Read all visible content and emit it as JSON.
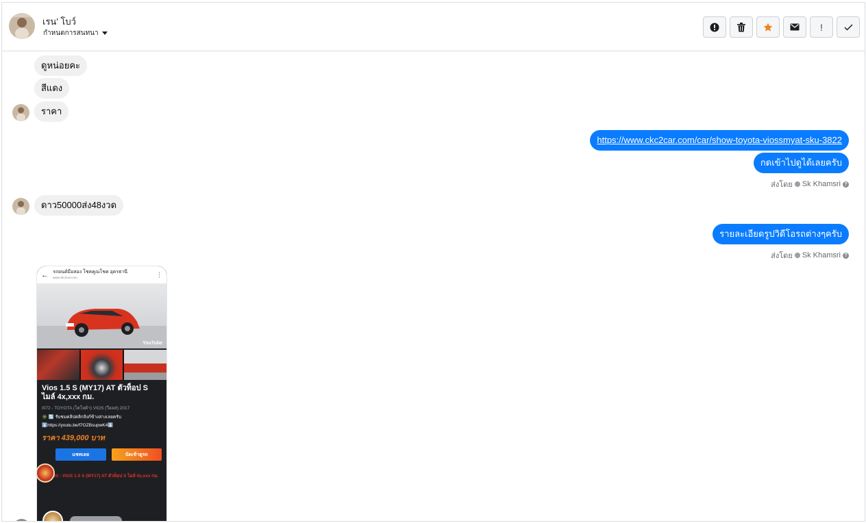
{
  "header": {
    "contact_name": "เรน' โบว์",
    "conversation_menu": "กำหนดการสนทนา"
  },
  "toolbar": [
    {
      "name": "spam-button",
      "icon": "alert-circle-icon"
    },
    {
      "name": "delete-button",
      "icon": "trash-icon"
    },
    {
      "name": "star-button",
      "icon": "star-icon",
      "color": "#f0821e"
    },
    {
      "name": "mark-unread-button",
      "icon": "envelope-icon"
    },
    {
      "name": "important-button",
      "icon": "exclamation-icon",
      "label": "!"
    },
    {
      "name": "done-button",
      "icon": "check-icon"
    }
  ],
  "messages": {
    "in_1": "ดูหน่อยคะ",
    "in_2": "สีแดง",
    "in_3": "ราคา",
    "out_link": "https://www.ckc2car.com/car/show-toyota-viossmyat-sku-3822",
    "out_2": "กดเข้าไปดูได้เลยครับ",
    "in_4": "ดาว50000ส่ง48งวด",
    "out_3": "รายละเอียดรูปวิดีโอรถต่างๆครับ"
  },
  "sent_by": {
    "prefix": "ส่งโดย",
    "agent": "Sk Khamsri"
  },
  "shared_image": {
    "page_title": "รถยนต์มือสอง โชคคูณโชค อุดรธานี",
    "page_url": "www.ckc2car.com",
    "video_badge": "YouTube",
    "car_title": "Vios 1.5 S (MY17) AT ตัวท็อป S ไมล์ 4x,xxx กม.",
    "car_sub": "I072 - TOYOTA (โตโยต้า) VIOS (วีออส) 2017",
    "car_line1": "✳️ 🔃 รับชมคลิปคลิกลิงก์ข้างล่างเลยครับ",
    "car_line2": "⬇️https://youtu.be/f7OZBsupwK4⬇️",
    "car_price": "ราคา 439,000 บาท",
    "btn_chat": "แชทเลย",
    "btn_book": "นัดเข้าดูรถ",
    "car_extra": "ข้อมูลรถ : VIOS 1.5 S (MY17) AT ตัวท็อป S ไมล์ 4x,xxx กม."
  },
  "colors": {
    "outgoing_bubble": "#0a7cff",
    "incoming_bubble": "#f0f0f0",
    "star": "#f0821e"
  }
}
